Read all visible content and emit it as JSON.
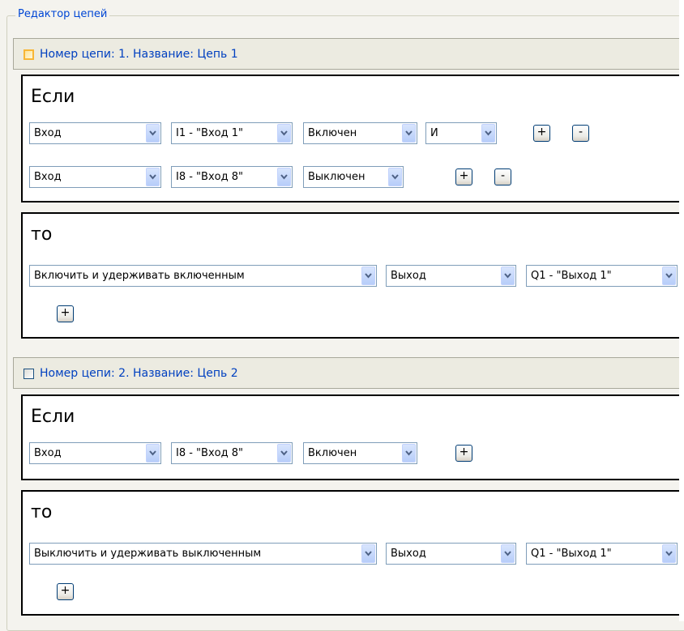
{
  "group_title": "Редактор цепей",
  "chains": [
    {
      "header": "Номер цепи: 1. Название: Цепь 1",
      "if_title": "Если",
      "if_rows": [
        {
          "type": "Вход",
          "item": "I1 - \"Вход 1\"",
          "state": "Включен",
          "logic": "И",
          "plus": "+",
          "minus": "-"
        },
        {
          "type": "Вход",
          "item": "I8 - \"Вход 8\"",
          "state": "Выключен",
          "plus": "+",
          "minus": "-"
        }
      ],
      "then_title": "то",
      "then_rows": [
        {
          "action": "Включить и удерживать включенным",
          "target_type": "Выход",
          "target": "Q1 - \"Выход 1\""
        }
      ],
      "then_add": "+"
    },
    {
      "header": "Номер цепи: 2. Название: Цепь 2",
      "if_title": "Если",
      "if_rows": [
        {
          "type": "Вход",
          "item": "I8 - \"Вход 8\"",
          "state": "Включен",
          "plus": "+"
        }
      ],
      "then_title": "то",
      "then_rows": [
        {
          "action": "Выключить и удерживать выключенным",
          "target_type": "Выход",
          "target": "Q1 - \"Выход 1\""
        }
      ],
      "then_add": "+"
    }
  ]
}
